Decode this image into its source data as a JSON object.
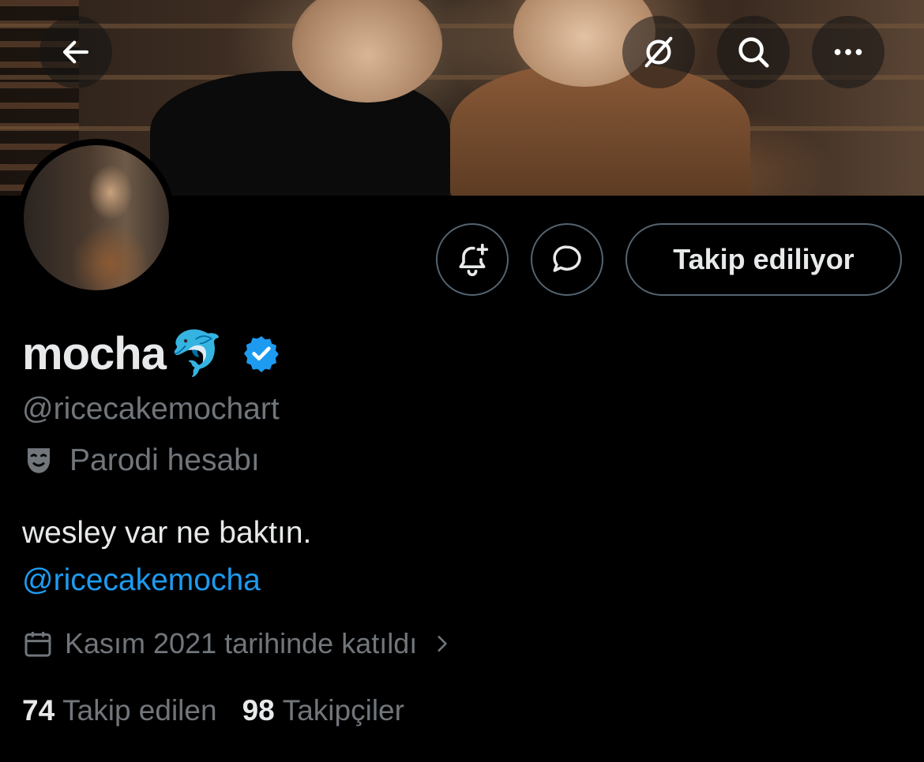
{
  "header": {
    "back_icon": "arrow-left-icon",
    "grok_icon": "grok-icon",
    "search_icon": "search-icon",
    "more_icon": "more-dots-icon"
  },
  "profile": {
    "display_name": "mocha",
    "name_emoji": "🐬",
    "verified": true,
    "handle": "@ricecakemochart",
    "parody_label": "Parodi hesabı",
    "bio": "wesley var ne baktın.",
    "bio_link": "@ricecakemocha",
    "joined": "Kasım 2021 tarihinde katıldı",
    "following_count": "74",
    "following_label": "Takip edilen",
    "followers_count": "98",
    "followers_label": "Takipçiler"
  },
  "actions": {
    "notify_icon": "bell-plus-icon",
    "message_icon": "message-bubble-icon",
    "follow_label": "Takip ediliyor"
  },
  "colors": {
    "background": "#000000",
    "text_primary": "#e7e9ea",
    "text_secondary": "#71767b",
    "link": "#1d9bf0",
    "border": "#536471",
    "verified_badge": "#1d9bf0"
  }
}
